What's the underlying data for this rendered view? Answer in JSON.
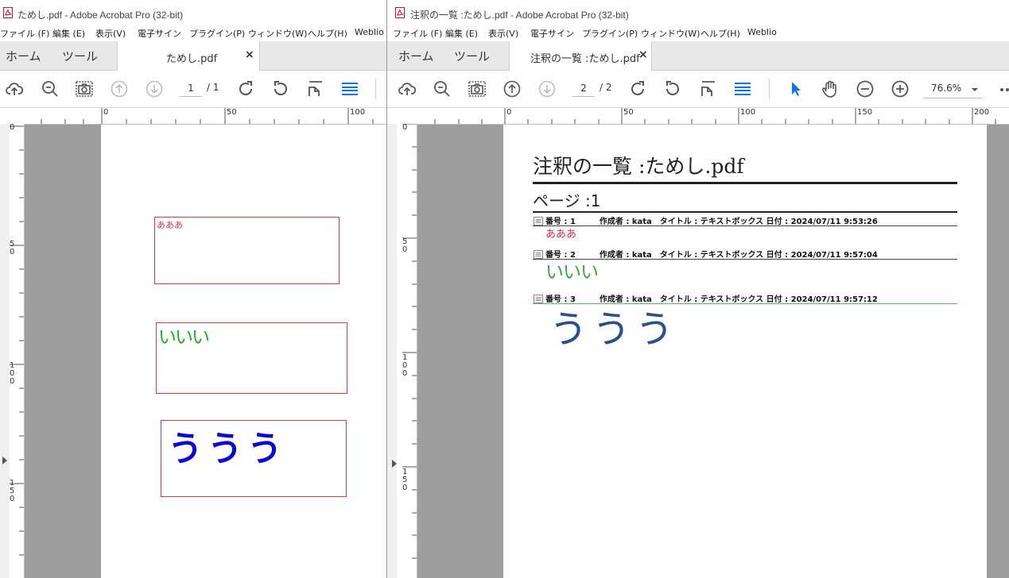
{
  "left_window": {
    "title": "ためし.pdf - Adobe Acrobat Pro (32-bit)",
    "menu": [
      "ファイル (F)",
      "編集 (E)",
      "表示(V)",
      "電子サイン",
      "プラグイン(P)",
      "ウィンドウ(W)",
      "ヘルプ(H)",
      "Weblio"
    ],
    "home_tab": "ホーム",
    "tools_tab": "ツール",
    "doc_tab": "ためし.pdf",
    "close_glyph": "×",
    "page_current": "1",
    "page_total": "/ 1",
    "ruler_h": [
      "0",
      "50",
      "100"
    ],
    "ruler_v": [
      "0",
      "50",
      "100",
      "150"
    ],
    "annotations": [
      {
        "text": "あああ",
        "color": "#e0354b"
      },
      {
        "text": "いいい",
        "color": "#1db31d"
      },
      {
        "text": "ううう",
        "color": "#0a0ad8"
      }
    ]
  },
  "right_window": {
    "title": "注釈の一覧 :ためし.pdf - Adobe Acrobat Pro (32-bit)",
    "menu": [
      "ファイル (F)",
      "編集 (E)",
      "表示(V)",
      "電子サイン",
      "プラグイン(P)",
      "ウィンドウ(W)",
      "ヘルプ(H)",
      "Weblio"
    ],
    "home_tab": "ホーム",
    "tools_tab": "ツール",
    "doc_tab": "注釈の一覧 :ためし.pdf",
    "close_glyph": "×",
    "page_current": "2",
    "page_total": "/ 2",
    "zoom": "76.6%",
    "ruler_h": [
      "0",
      "50",
      "100",
      "150",
      "200"
    ],
    "ruler_v": [
      "0",
      "50",
      "100",
      "150"
    ],
    "doc": {
      "heading": "注釈の一覧 :ためし.pdf",
      "page_label": "ページ :1",
      "entries": [
        {
          "meta": "番号 : 1　　　作成者 : kata　タイトル : テキストボックス 日付 : 2024/07/11 9:53:26",
          "content": "あああ",
          "color": "#d0304a"
        },
        {
          "meta": "番号 : 2　　　作成者 : kata　タイトル : テキストボックス 日付 : 2024/07/11 9:57:04",
          "content": "いいい",
          "color": "#3aa83a"
        },
        {
          "meta": "番号 : 3　　　作成者 : kata　タイトル : テキストボックス 日付 : 2024/07/11 9:57:12",
          "content": "ううう",
          "color": "#2a4f8f"
        }
      ]
    }
  },
  "colors": {
    "accent": "#1473e6",
    "ruler_gray": "#9d9d9d",
    "tab_bg": "#e8e8e8"
  }
}
